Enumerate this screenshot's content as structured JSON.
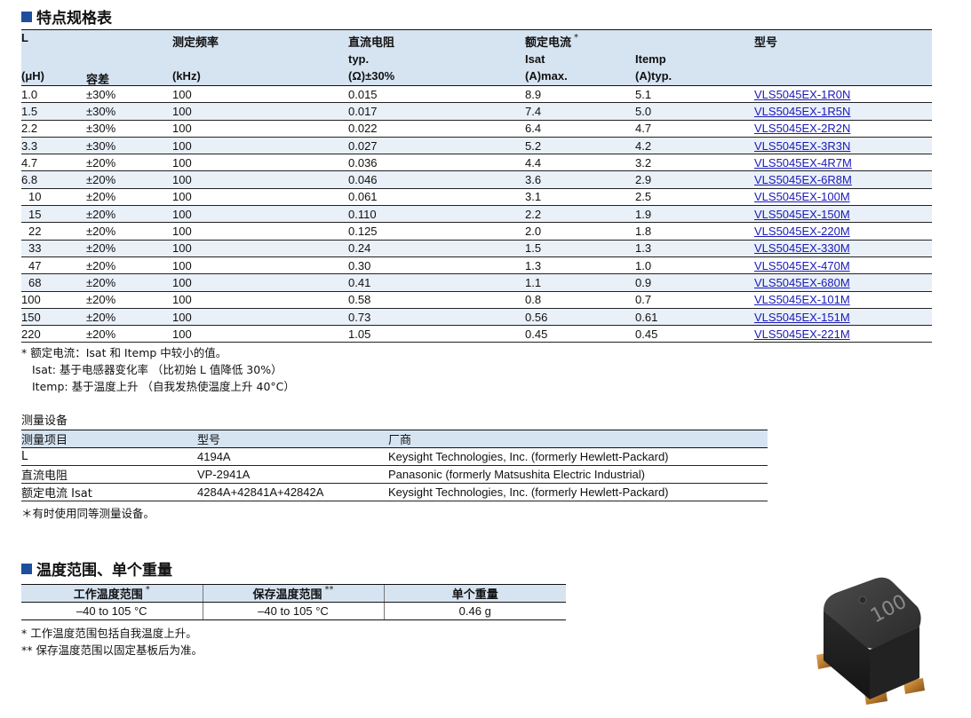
{
  "spec_section": {
    "title": "特点规格表",
    "headers": {
      "L": "L",
      "L_unit": "(μH)",
      "tolerance": "容差",
      "freq": "测定频率",
      "freq_unit": "(kHz)",
      "dcr": "直流电阻",
      "dcr_sub": "typ.",
      "dcr_unit": "(Ω)±30%",
      "rated_current": "额定电流",
      "rated_mark": "*",
      "isat": "Isat",
      "isat_unit": "(A)max.",
      "itemp": "Itemp",
      "itemp_unit": "(A)typ.",
      "part": "型号"
    },
    "rows": [
      {
        "l": "1.0",
        "tol": "±30%",
        "freq": "100",
        "dcr": "0.015",
        "isat": "8.9",
        "itemp": "5.1",
        "part": "VLS5045EX-1R0N"
      },
      {
        "l": "1.5",
        "tol": "±30%",
        "freq": "100",
        "dcr": "0.017",
        "isat": "7.4",
        "itemp": "5.0",
        "part": "VLS5045EX-1R5N"
      },
      {
        "l": "2.2",
        "tol": "±30%",
        "freq": "100",
        "dcr": "0.022",
        "isat": "6.4",
        "itemp": "4.7",
        "part": "VLS5045EX-2R2N"
      },
      {
        "l": "3.3",
        "tol": "±30%",
        "freq": "100",
        "dcr": "0.027",
        "isat": "5.2",
        "itemp": "4.2",
        "part": "VLS5045EX-3R3N"
      },
      {
        "l": "4.7",
        "tol": "±20%",
        "freq": "100",
        "dcr": "0.036",
        "isat": "4.4",
        "itemp": "3.2",
        "part": "VLS5045EX-4R7M"
      },
      {
        "l": "6.8",
        "tol": "±20%",
        "freq": "100",
        "dcr": "0.046",
        "isat": "3.6",
        "itemp": "2.9",
        "part": "VLS5045EX-6R8M"
      },
      {
        "l": "10",
        "tol": "±20%",
        "freq": "100",
        "dcr": "0.061",
        "isat": "3.1",
        "itemp": "2.5",
        "part": "VLS5045EX-100M"
      },
      {
        "l": "15",
        "tol": "±20%",
        "freq": "100",
        "dcr": "0.110",
        "isat": "2.2",
        "itemp": "1.9",
        "part": "VLS5045EX-150M"
      },
      {
        "l": "22",
        "tol": "±20%",
        "freq": "100",
        "dcr": "0.125",
        "isat": "2.0",
        "itemp": "1.8",
        "part": "VLS5045EX-220M"
      },
      {
        "l": "33",
        "tol": "±20%",
        "freq": "100",
        "dcr": "0.24",
        "isat": "1.5",
        "itemp": "1.3",
        "part": "VLS5045EX-330M"
      },
      {
        "l": "47",
        "tol": "±20%",
        "freq": "100",
        "dcr": "0.30",
        "isat": "1.3",
        "itemp": "1.0",
        "part": "VLS5045EX-470M"
      },
      {
        "l": "68",
        "tol": "±20%",
        "freq": "100",
        "dcr": "0.41",
        "isat": "1.1",
        "itemp": "0.9",
        "part": "VLS5045EX-680M"
      },
      {
        "l": "100",
        "tol": "±20%",
        "freq": "100",
        "dcr": "0.58",
        "isat": "0.8",
        "itemp": "0.7",
        "part": "VLS5045EX-101M"
      },
      {
        "l": "150",
        "tol": "±20%",
        "freq": "100",
        "dcr": "0.73",
        "isat": "0.56",
        "itemp": "0.61",
        "part": "VLS5045EX-151M"
      },
      {
        "l": "220",
        "tol": "±20%",
        "freq": "100",
        "dcr": "1.05",
        "isat": "0.45",
        "itemp": "0.45",
        "part": "VLS5045EX-221M"
      }
    ],
    "notes": [
      "*  额定电流：Isat 和 Itemp 中较小的值。",
      "Isat: 基于电感器变化率 （比初始 L 值降低 30%）",
      "Itemp: 基于温度上升 （自我发热使温度上升 40°C）"
    ]
  },
  "equipment": {
    "caption": "测量设备",
    "headers": {
      "item": "测量项目",
      "model": "型号",
      "maker": "厂商"
    },
    "rows": [
      {
        "item": "L",
        "model": "4194A",
        "maker": "Keysight Technologies, Inc. (formerly Hewlett-Packard)"
      },
      {
        "item": "直流电阻",
        "model": "VP-2941A",
        "maker": "Panasonic (formerly Matsushita Electric Industrial)"
      },
      {
        "item": "额定电流 Isat",
        "model": "4284A+42841A+42842A",
        "maker": "Keysight Technologies, Inc. (formerly Hewlett-Packard)"
      }
    ],
    "note": "＊有时使用同等测量设备。"
  },
  "temp_section": {
    "title": "温度范围、单个重量",
    "headers": {
      "operating": "工作温度范围",
      "operating_mark": "*",
      "storage": "保存温度范围",
      "storage_mark": "**",
      "weight": "单个重量"
    },
    "values": {
      "operating": "–40 to 105 °C",
      "storage": "–40 to 105 °C",
      "weight": "0.46 g"
    },
    "notes": [
      "*   工作温度范围包括自我温度上升。",
      "** 保存温度范围以固定基板后为准。"
    ]
  },
  "photo": {
    "marking": "100"
  },
  "colors": {
    "header_bg": "#d6e4f2",
    "stripe_bg": "#e9f0f8",
    "accent": "#1e4f9c",
    "link": "#1a1ab8"
  }
}
